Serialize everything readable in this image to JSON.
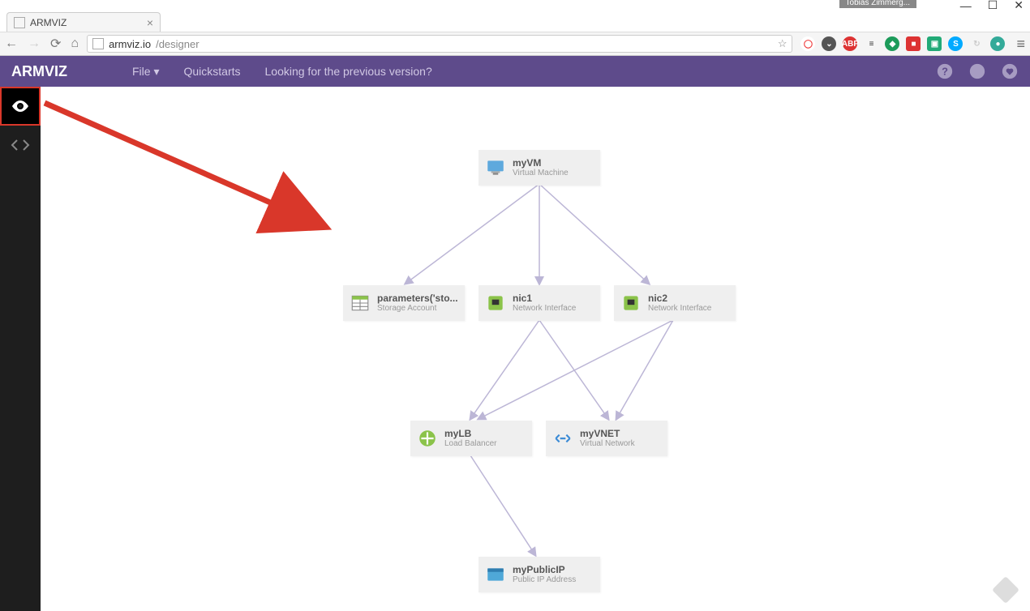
{
  "window": {
    "profile_label": "Tobias Zimmerg...",
    "controls": {
      "min": "—",
      "max": "☐",
      "close": "✕"
    }
  },
  "browser": {
    "tab_title": "ARMVIZ",
    "url_host": "armviz.io",
    "url_path": "/designer"
  },
  "header": {
    "brand": "ARMVIZ",
    "menu": {
      "file": "File",
      "quickstarts": "Quickstarts",
      "previous": "Looking for the previous version?"
    }
  },
  "nodes": {
    "vm": {
      "title": "myVM",
      "sub": "Virtual Machine"
    },
    "storage": {
      "title": "parameters('sto...",
      "sub": "Storage Account"
    },
    "nic1": {
      "title": "nic1",
      "sub": "Network Interface"
    },
    "nic2": {
      "title": "nic2",
      "sub": "Network Interface"
    },
    "lb": {
      "title": "myLB",
      "sub": "Load Balancer"
    },
    "vnet": {
      "title": "myVNET",
      "sub": "Virtual Network"
    },
    "pip": {
      "title": "myPublicIP",
      "sub": "Public IP Address"
    }
  }
}
